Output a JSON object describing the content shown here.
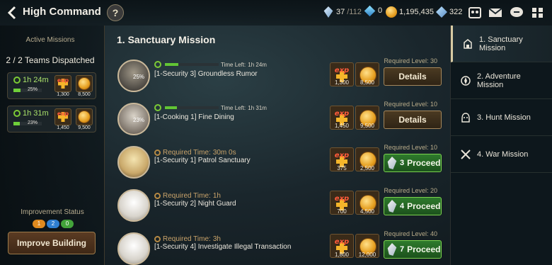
{
  "header": {
    "title": "High Command",
    "help_label": "?",
    "stigma_current": "37",
    "stigma_max": "/112",
    "crystal_count": "0",
    "gold": "1,195,435",
    "skystone": "322"
  },
  "left": {
    "active_missions_label": "Active Missions",
    "teams_dispatched": "2 / 2 Teams Dispatched",
    "teams": [
      {
        "time": "1h 24m",
        "progress_percent": 25,
        "progress_label": "25%",
        "exp": "1,300",
        "gold": "8,500"
      },
      {
        "time": "1h 31m",
        "progress_percent": 23,
        "progress_label": "23%",
        "exp": "1,450",
        "gold": "9,500"
      }
    ],
    "improvement_label": "Improvement Status",
    "badges": [
      "1",
      "2",
      "0"
    ],
    "improve_button": "Improve Building"
  },
  "section_title": "1. Sanctuary Mission",
  "missions": [
    {
      "status": "active",
      "time_left_label": "Time Left:",
      "time_left": "1h 24m",
      "progress": 0.25,
      "avatar_timer": "25%",
      "name": "[1-Security 3] Groundless Rumor",
      "exp": "1,300",
      "gold": "8,500",
      "required_level": "Required Level: 30",
      "action": "Details"
    },
    {
      "status": "active",
      "time_left_label": "Time Left:",
      "time_left": "1h 31m",
      "progress": 0.23,
      "avatar_timer": "23%",
      "name": "[1-Cooking 1] Fine Dining",
      "exp": "1,450",
      "gold": "9,500",
      "required_level": "Required Level: 10",
      "action": "Details"
    },
    {
      "status": "available",
      "required_time_label": "Required Time:",
      "required_time": "30m 0s",
      "name": "[1-Security 1] Patrol Sanctuary",
      "exp": "375",
      "gold": "2,500",
      "required_level": "Required Level: 10",
      "cost": "3",
      "action": "Proceed"
    },
    {
      "status": "available",
      "required_time_label": "Required Time:",
      "required_time": "1h",
      "name": "[1-Security 2] Night Guard",
      "exp": "700",
      "gold": "4,500",
      "required_level": "Required Level: 20",
      "cost": "4",
      "action": "Proceed"
    },
    {
      "status": "available",
      "required_time_label": "Required Time:",
      "required_time": "3h",
      "name": "[1-Security 4] Investigate Illegal Transaction",
      "exp": "1,800",
      "gold": "12,000",
      "required_level": "Required Level: 40",
      "cost": "7",
      "action": "Proceed"
    }
  ],
  "exp_label": "exp",
  "tabs": [
    {
      "label": "1. Sanctuary Mission",
      "icon": "sanctuary-icon",
      "active": true
    },
    {
      "label": "2. Adventure Mission",
      "icon": "adventure-icon",
      "active": false
    },
    {
      "label": "3. Hunt Mission",
      "icon": "hunt-icon",
      "active": false
    },
    {
      "label": "4. War Mission",
      "icon": "war-icon",
      "active": false
    }
  ],
  "colors": {
    "accent_green": "#6fcf3a",
    "proceed_green": "#2e7a2c",
    "gold": "#e59e1f"
  }
}
